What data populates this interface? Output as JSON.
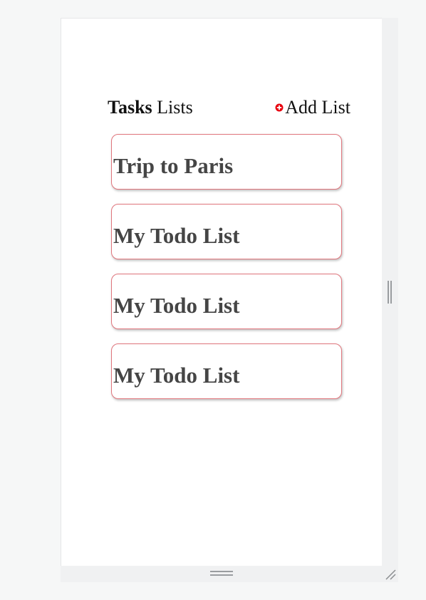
{
  "header": {
    "title_bold": "Tasks",
    "title_rest": " Lists",
    "add_label": "Add List",
    "add_icon": "plus-circle-icon",
    "accent_color": "#e8000d"
  },
  "lists": [
    {
      "title": "Trip to Paris"
    },
    {
      "title": "My Todo List"
    },
    {
      "title": "My Todo List"
    },
    {
      "title": "My Todo List"
    }
  ],
  "colors": {
    "card_border": "#e0757c",
    "card_text": "#454545",
    "page_background": "#f6f7f7",
    "frame_background": "#ffffff"
  }
}
